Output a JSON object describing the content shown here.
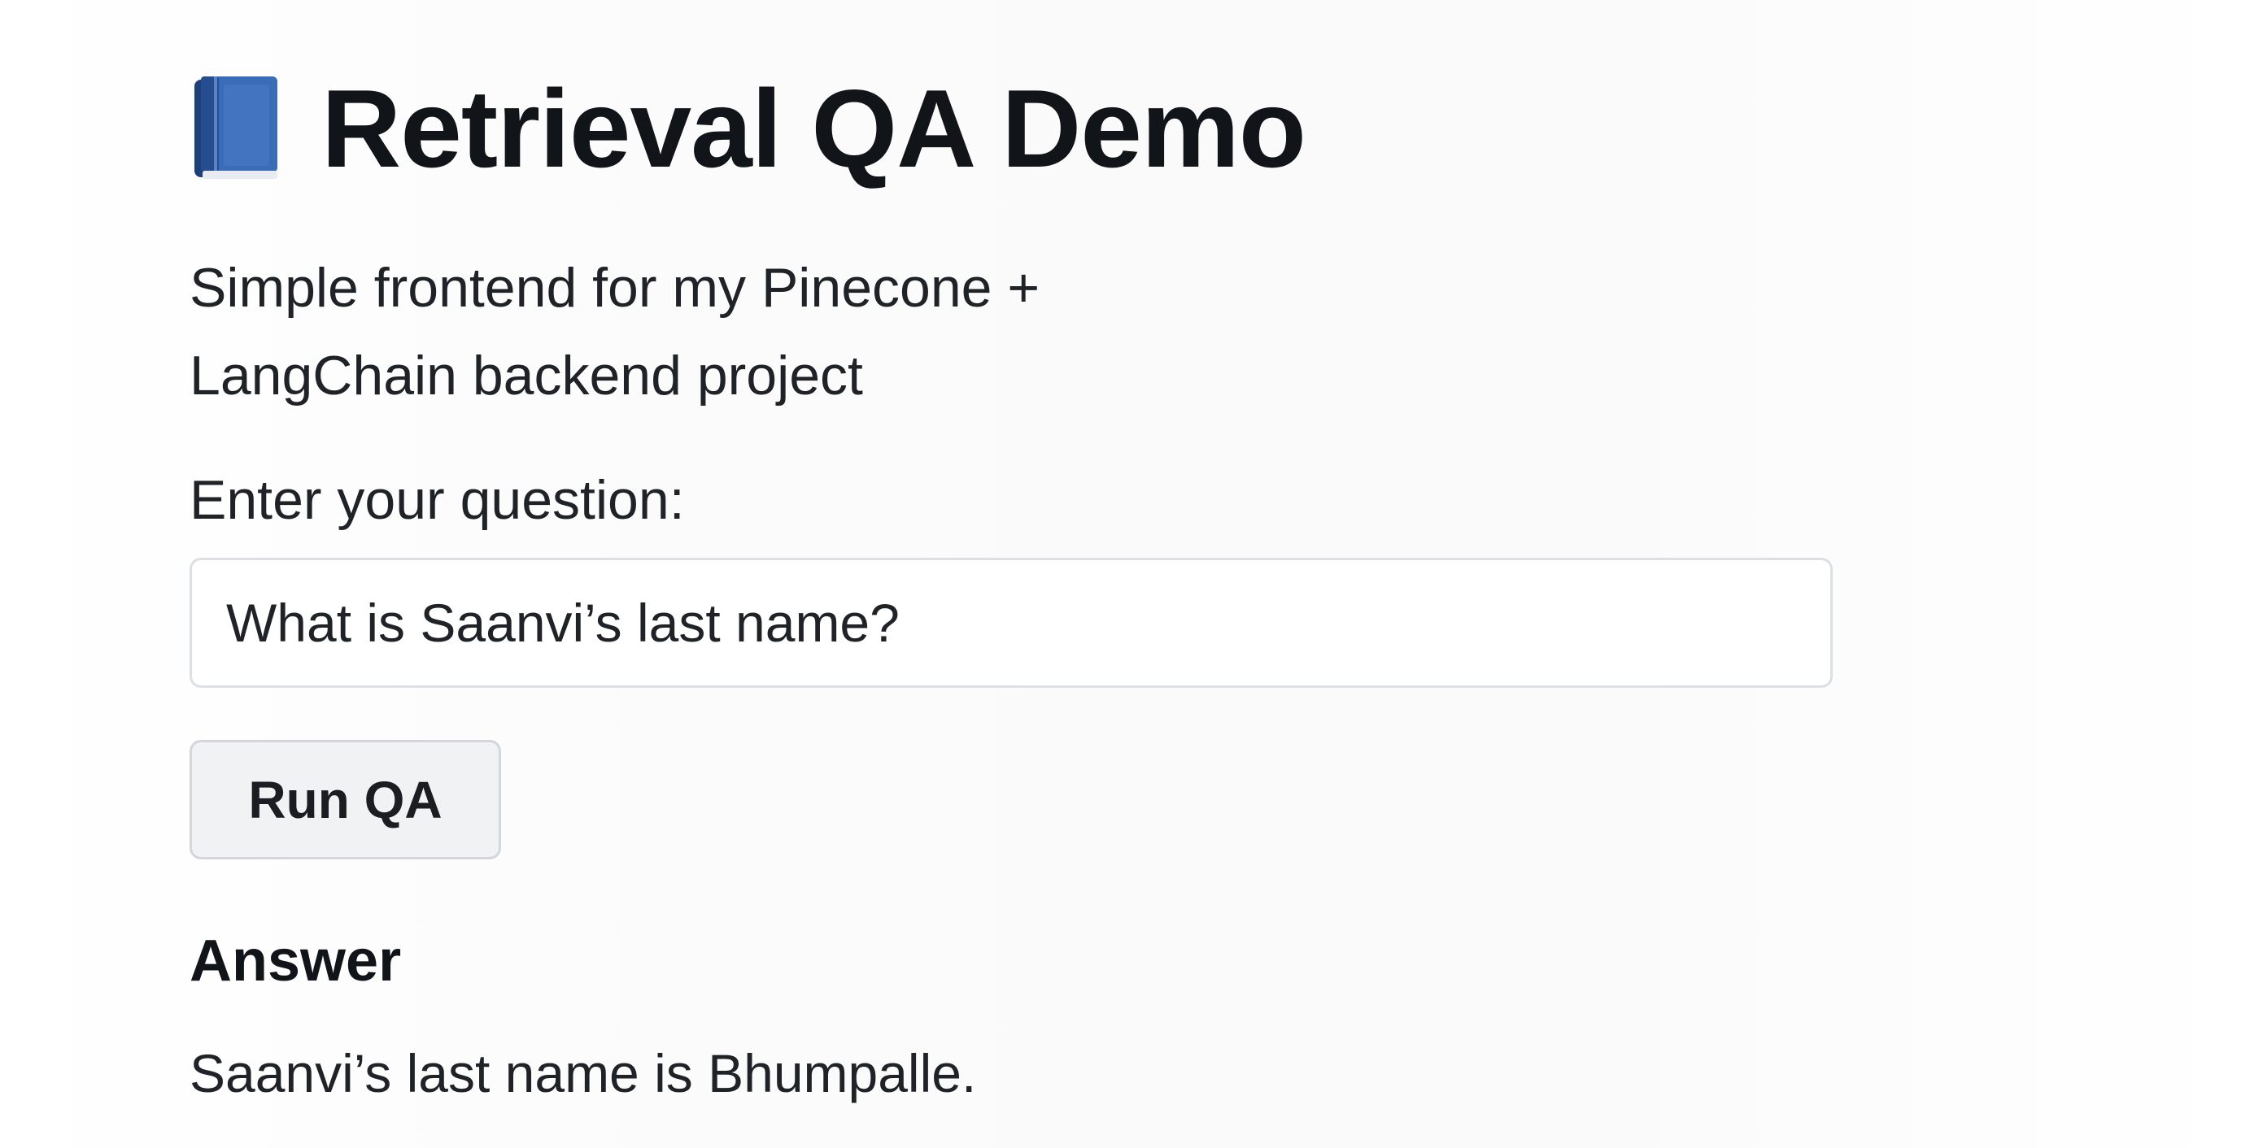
{
  "header": {
    "title": "Retrieval QA Demo",
    "icon": "blue-book-icon",
    "subtitle": "Simple frontend for my Pinecone + LangChain backend project"
  },
  "form": {
    "question_label": "Enter your question:",
    "question_value": "What is Saanvi’s last name?",
    "run_button_label": "Run QA"
  },
  "answer": {
    "heading": "Answer",
    "text": "Saanvi’s last name is Bhumpalle."
  },
  "colors": {
    "book_cover": "#2f5fa8",
    "book_spine": "#1f3f78",
    "button_bg": "#f1f2f4",
    "input_border": "#dcdfe3"
  }
}
